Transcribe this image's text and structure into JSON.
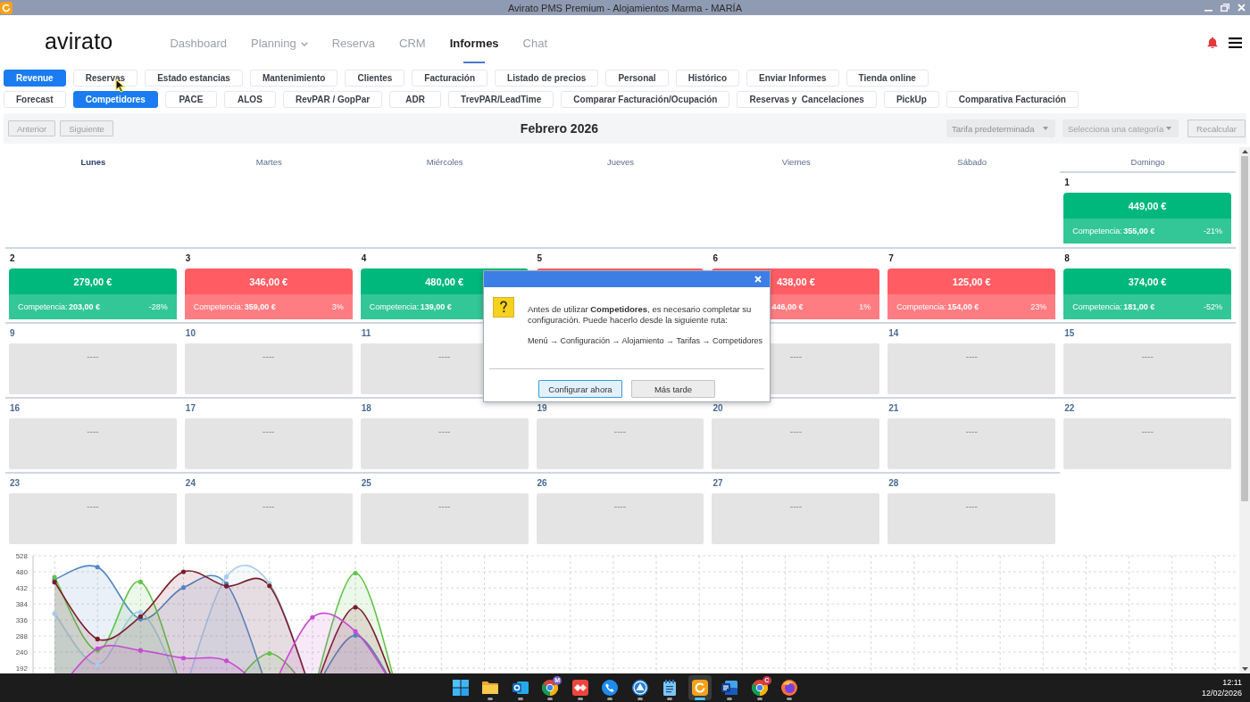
{
  "window": {
    "title": "Avirato PMS Premium - Alojamientos Marma - MARÍA"
  },
  "header": {
    "logo": "avirato",
    "nav": [
      {
        "label": "Dashboard",
        "selected": false,
        "dropdown": false
      },
      {
        "label": "Planning",
        "selected": false,
        "dropdown": true
      },
      {
        "label": "Reserva",
        "selected": false,
        "dropdown": false
      },
      {
        "label": "CRM",
        "selected": false,
        "dropdown": false
      },
      {
        "label": "Informes",
        "selected": true,
        "dropdown": false
      },
      {
        "label": "Chat",
        "selected": false,
        "dropdown": false
      }
    ]
  },
  "report_tabs": [
    {
      "label": "Revenue",
      "selected": true
    },
    {
      "label": "Reservas",
      "selected": false
    },
    {
      "label": "Estado estancias",
      "selected": false
    },
    {
      "label": "Mantenimiento",
      "selected": false
    },
    {
      "label": "Clientes",
      "selected": false
    },
    {
      "label": "Facturación",
      "selected": false
    },
    {
      "label": "Listado de precios",
      "selected": false
    },
    {
      "label": "Personal",
      "selected": false
    },
    {
      "label": "Histórico",
      "selected": false
    },
    {
      "label": "Enviar Informes",
      "selected": false
    },
    {
      "label": "Tienda online",
      "selected": false
    }
  ],
  "revenue_tabs": [
    {
      "label": "Forecast",
      "selected": false
    },
    {
      "label": "Competidores",
      "selected": true
    },
    {
      "label": "PACE",
      "selected": false
    },
    {
      "label": "ALOS",
      "selected": false
    },
    {
      "label": "RevPAR / GopPar",
      "selected": false
    },
    {
      "label": "ADR",
      "selected": false
    },
    {
      "label": "TrevPAR/LeadTime",
      "selected": false
    },
    {
      "label": "Comparar Facturación/Ocupación",
      "selected": false
    },
    {
      "label": "Reservas y  Cancelaciones",
      "selected": false
    },
    {
      "label": "PickUp",
      "selected": false
    },
    {
      "label": "Comparativa Facturación",
      "selected": false
    }
  ],
  "toolbar": {
    "previous": "Anterior",
    "next": "Siguiente",
    "title": "Febrero 2026",
    "rate_select": {
      "value": "Tarifa predeterminada"
    },
    "category_select": {
      "placeholder": "Selecciona una categoría"
    },
    "recalculate": "Recalcular"
  },
  "calendar": {
    "weekdays": [
      {
        "label": "Lunes",
        "selected": true
      },
      {
        "label": "Martes",
        "selected": false
      },
      {
        "label": "Miércoles",
        "selected": false
      },
      {
        "label": "Jueves",
        "selected": false
      },
      {
        "label": "Viernes",
        "selected": false
      },
      {
        "label": "Sábado",
        "selected": false
      },
      {
        "label": "Domingo",
        "selected": false
      }
    ],
    "weeks": [
      [
        {
          "kind": "blank"
        },
        {
          "kind": "blank"
        },
        {
          "kind": "blank"
        },
        {
          "kind": "blank"
        },
        {
          "kind": "blank"
        },
        {
          "kind": "blank"
        },
        {
          "day": "1",
          "kind": "price",
          "color": "#00b87c",
          "price": "449,00 €",
          "competition_label": "Competencia:",
          "competition": "355,00 €",
          "difference": "-21%"
        }
      ],
      [
        {
          "day": "2",
          "kind": "price",
          "color": "#00b87c",
          "price": "279,00 €",
          "competition_label": "Competencia:",
          "competition": "203,00 €",
          "difference": "-28%"
        },
        {
          "day": "3",
          "kind": "price",
          "color": "#ff5d63",
          "price": "346,00 €",
          "competition_label": "Competencia:",
          "competition": "359,00 €",
          "difference": "3%"
        },
        {
          "day": "4",
          "kind": "price",
          "color": "#00b87c",
          "price": "480,00 €",
          "competition_label": "Competencia:",
          "competition": "139,00 €"
        },
        {
          "day": "5",
          "kind": "price",
          "color": "#ff5d63"
        },
        {
          "day": "6",
          "kind": "price",
          "color": "#ff5d63",
          "price": "438,00 €",
          "competition": "446,00 €",
          "difference": "1%"
        },
        {
          "day": "7",
          "kind": "price",
          "color": "#ff5d63",
          "price": "125,00 €",
          "competition_label": "Competencia:",
          "competition": "154,00 €",
          "difference": "23%"
        },
        {
          "day": "8",
          "kind": "price",
          "color": "#00b87c",
          "price": "374,00 €",
          "competition_label": "Competencia:",
          "competition": "181,00 €",
          "difference": "-52%"
        }
      ],
      [
        {
          "day": "9",
          "kind": "none",
          "placeholder": "----"
        },
        {
          "day": "10",
          "kind": "none",
          "placeholder": "----"
        },
        {
          "day": "11",
          "kind": "none",
          "placeholder": "----"
        },
        {
          "kind": "none"
        },
        {
          "kind": "none",
          "placeholder": "----"
        },
        {
          "day": "14",
          "kind": "none",
          "placeholder": "----"
        },
        {
          "day": "15",
          "kind": "none",
          "placeholder": "----"
        }
      ],
      [
        {
          "day": "16",
          "kind": "none",
          "placeholder": "----"
        },
        {
          "day": "17",
          "kind": "none",
          "placeholder": "----"
        },
        {
          "day": "18",
          "kind": "none",
          "placeholder": "----"
        },
        {
          "day": "19",
          "kind": "none",
          "placeholder": "----"
        },
        {
          "day": "20",
          "kind": "none",
          "placeholder": "----"
        },
        {
          "day": "21",
          "kind": "none",
          "placeholder": "----"
        },
        {
          "day": "22",
          "kind": "none",
          "placeholder": "----"
        }
      ],
      [
        {
          "day": "23",
          "kind": "none",
          "placeholder": "----"
        },
        {
          "day": "24",
          "kind": "none",
          "placeholder": "----"
        },
        {
          "day": "25",
          "kind": "none",
          "placeholder": "----"
        },
        {
          "day": "26",
          "kind": "none",
          "placeholder": "----"
        },
        {
          "day": "27",
          "kind": "none",
          "placeholder": "----"
        },
        {
          "day": "28",
          "kind": "none",
          "placeholder": "----"
        },
        {
          "kind": "blank"
        }
      ]
    ]
  },
  "chart": {
    "chart_data": {
      "type": "area",
      "grid": true,
      "ylim": [
        192,
        528
      ],
      "yticks": [
        192,
        240,
        288,
        336,
        384,
        432,
        480,
        528
      ],
      "series": [
        {
          "color": "#4f86c6",
          "values": [
            457,
            494,
            339,
            433,
            444,
            null,
            null,
            290,
            null,
            null,
            null,
            null,
            null,
            null,
            null,
            null,
            null,
            null,
            null,
            null,
            null,
            null,
            null,
            null,
            null,
            null,
            null,
            null
          ]
        },
        {
          "color": "#a9cbea",
          "values": [
            355,
            203,
            359,
            null,
            465,
            446,
            null,
            null,
            null,
            null,
            null,
            null,
            null,
            null,
            null,
            null,
            null,
            null,
            null,
            null,
            null,
            null,
            null,
            null,
            null,
            null,
            null,
            null
          ]
        },
        {
          "color": "#62c449",
          "values": [
            464,
            245,
            450,
            null,
            null,
            236,
            null,
            476,
            null,
            null,
            null,
            null,
            null,
            null,
            null,
            null,
            null,
            null,
            null,
            null,
            null,
            null,
            null,
            null,
            null,
            null,
            null,
            null
          ]
        },
        {
          "color": "#7b1c2a",
          "values": [
            449,
            279,
            346,
            480,
            437,
            438,
            null,
            374,
            null,
            null,
            null,
            null,
            null,
            null,
            null,
            null,
            null,
            null,
            null,
            null,
            null,
            null,
            null,
            null,
            null,
            null,
            null,
            null
          ]
        },
        {
          "color": "#c84bd1",
          "values": [
            null,
            250,
            245,
            222,
            214,
            null,
            344,
            302,
            null,
            null,
            null,
            null,
            null,
            null,
            null,
            null,
            null,
            null,
            null,
            null,
            null,
            null,
            null,
            null,
            null,
            null,
            null,
            null
          ]
        }
      ]
    }
  },
  "dialog": {
    "message": "Antes de utilizar **Competidores**, es necesario completar su configuración. Puede hacerlo desde la siguiente ruta:",
    "path": "Menú → Configuración → Alojamiento → Tarifas → Competidores",
    "buttons": [
      {
        "label": "Configurar ahora",
        "focused": true
      },
      {
        "label": "Más tarde",
        "focused": false
      }
    ]
  },
  "taskbar": {
    "apps": [
      {
        "kind": "start",
        "running": false,
        "active": false
      },
      {
        "kind": "folder",
        "running": true,
        "active": false
      },
      {
        "kind": "mail",
        "running": true,
        "active": false
      },
      {
        "kind": "browser",
        "running": true,
        "active": false,
        "badge": "M",
        "color": "#7b5fc7"
      },
      {
        "kind": "remote",
        "running": true,
        "active": false
      },
      {
        "kind": "phone",
        "running": true,
        "active": false
      },
      {
        "kind": "triangle",
        "running": true,
        "active": false
      },
      {
        "kind": "notepad",
        "running": true,
        "active": false
      },
      {
        "kind": "app",
        "running": true,
        "active": true
      },
      {
        "kind": "document",
        "running": true,
        "active": false
      },
      {
        "kind": "browser",
        "running": true,
        "active": false,
        "badge": "C",
        "color": "#d0344a"
      },
      {
        "kind": "globe",
        "running": true,
        "active": false
      }
    ],
    "time": "12:11",
    "date": "12/02/2026"
  }
}
